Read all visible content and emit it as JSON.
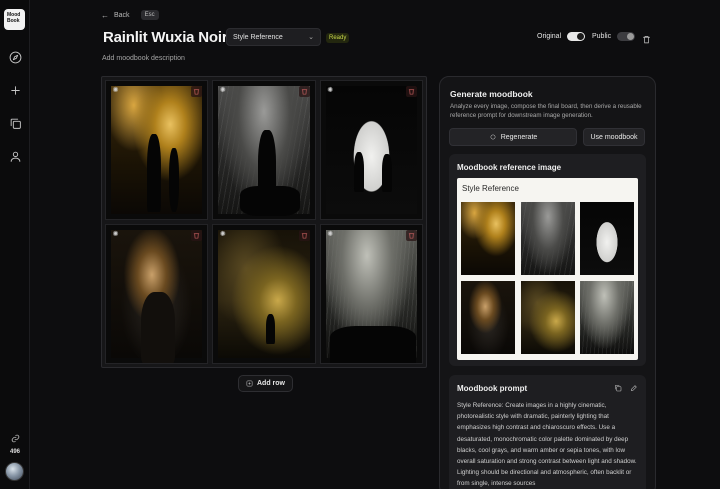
{
  "sidebar": {
    "logo_line1": "Mood",
    "logo_line2": "Book",
    "credits": "496"
  },
  "header": {
    "back_label": "Back",
    "esc_label": "Esc",
    "title": "Rainlit Wuxia Noir",
    "style_select_value": "Style Reference",
    "status_badge": "Ready",
    "description_placeholder": "Add moodbook description",
    "original_label": "Original",
    "public_label": "Public"
  },
  "board": {
    "add_row_label": "Add row"
  },
  "panel": {
    "title": "Generate moodbook",
    "subtitle": "Analyze every image, compose the final board, then derive a reusable reference prompt for downstream image generation.",
    "regenerate_label": "Regenerate",
    "use_label": "Use moodbook",
    "reference_title": "Moodbook reference image",
    "sheet_label": "Style Reference",
    "prompt_title": "Moodbook prompt",
    "prompt_text": "Style Reference:  Create images in a highly cinematic, photorealistic style with dramatic, painterly lighting that emphasizes high contrast and chiaroscuro effects. Use a desaturated, monochromatic color palette dominated by deep blacks, cool grays, and warm amber or sepia tones, with low overall saturation and strong contrast between light and shadow. Lighting should be directional and atmospheric, often backlit or from single, intense sources"
  },
  "icons": {
    "nav": [
      "compass-icon",
      "plus-icon",
      "copy-icon",
      "user-icon"
    ],
    "credits": "link-icon",
    "tile_settings": "sparkle-icon",
    "tile_delete": "trash-icon",
    "prompt_actions": [
      "copy-icon",
      "edit-icon"
    ]
  },
  "colors": {
    "background": "#0d0d0f",
    "panel": "#141416",
    "card": "#1e1e21",
    "ready_text": "#c7d64a",
    "delete_icon": "#e06a6a"
  }
}
